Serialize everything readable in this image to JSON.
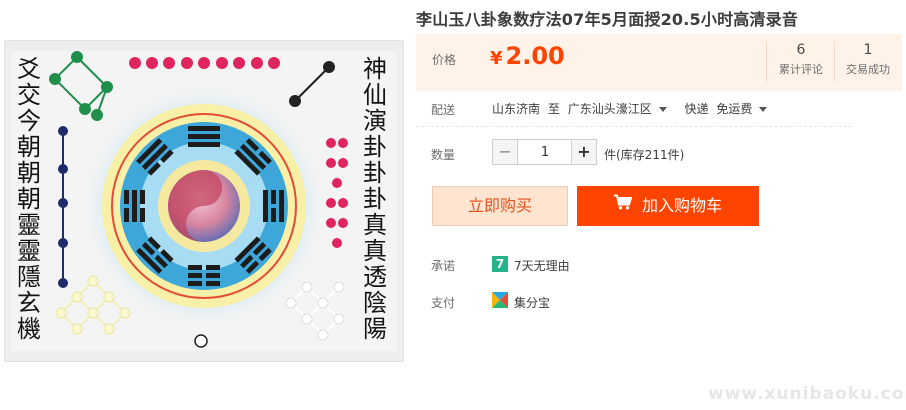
{
  "product": {
    "title": "李山玉八卦象数疗法07年5月面授20.5小时高清录音",
    "image": {
      "left_column": [
        "爻",
        "交",
        "今",
        "朝",
        "朝",
        "朝",
        "靈",
        "靈",
        "隱",
        "玄",
        "機"
      ],
      "right_column": [
        "神",
        "仙",
        "演",
        "卦",
        "卦",
        "卦",
        "真",
        "真",
        "透",
        "陰",
        "陽"
      ],
      "colors": {
        "outer_glow": "#bfe7f6",
        "ring_yellow": "#f8f0a6",
        "ring_red": "#e24b39",
        "inner_blue": "#3da7d9",
        "center_pink": "#e5aac2",
        "trigram": "#1c1c1c"
      }
    }
  },
  "price_panel": {
    "label": "价格",
    "currency": "¥",
    "amount": "2.00",
    "stats": [
      {
        "value": "6",
        "label": "累计评论"
      },
      {
        "value": "1",
        "label": "交易成功"
      }
    ]
  },
  "shipping": {
    "label": "配送",
    "from": "山东济南",
    "to_word": "至",
    "destination": "广东汕头濠江区",
    "method": "快递",
    "fee": "免运费"
  },
  "quantity": {
    "label": "数量",
    "value": "1",
    "minus": "−",
    "plus": "+",
    "stock_text": "件(库存211件)"
  },
  "actions": {
    "buy_now": "立即购买",
    "add_to_cart": "加入购物车"
  },
  "promise": {
    "label": "承诺",
    "badge": "7",
    "text": "7天无理由"
  },
  "payment": {
    "label": "支付",
    "text": "集分宝"
  },
  "watermark": "www.xunibaoku.com",
  "colors": {
    "accent": "#ff4400",
    "price_bg": "#fff2e8",
    "buy_bg": "#ffe4d0",
    "promise_badge": "#23b28a"
  }
}
